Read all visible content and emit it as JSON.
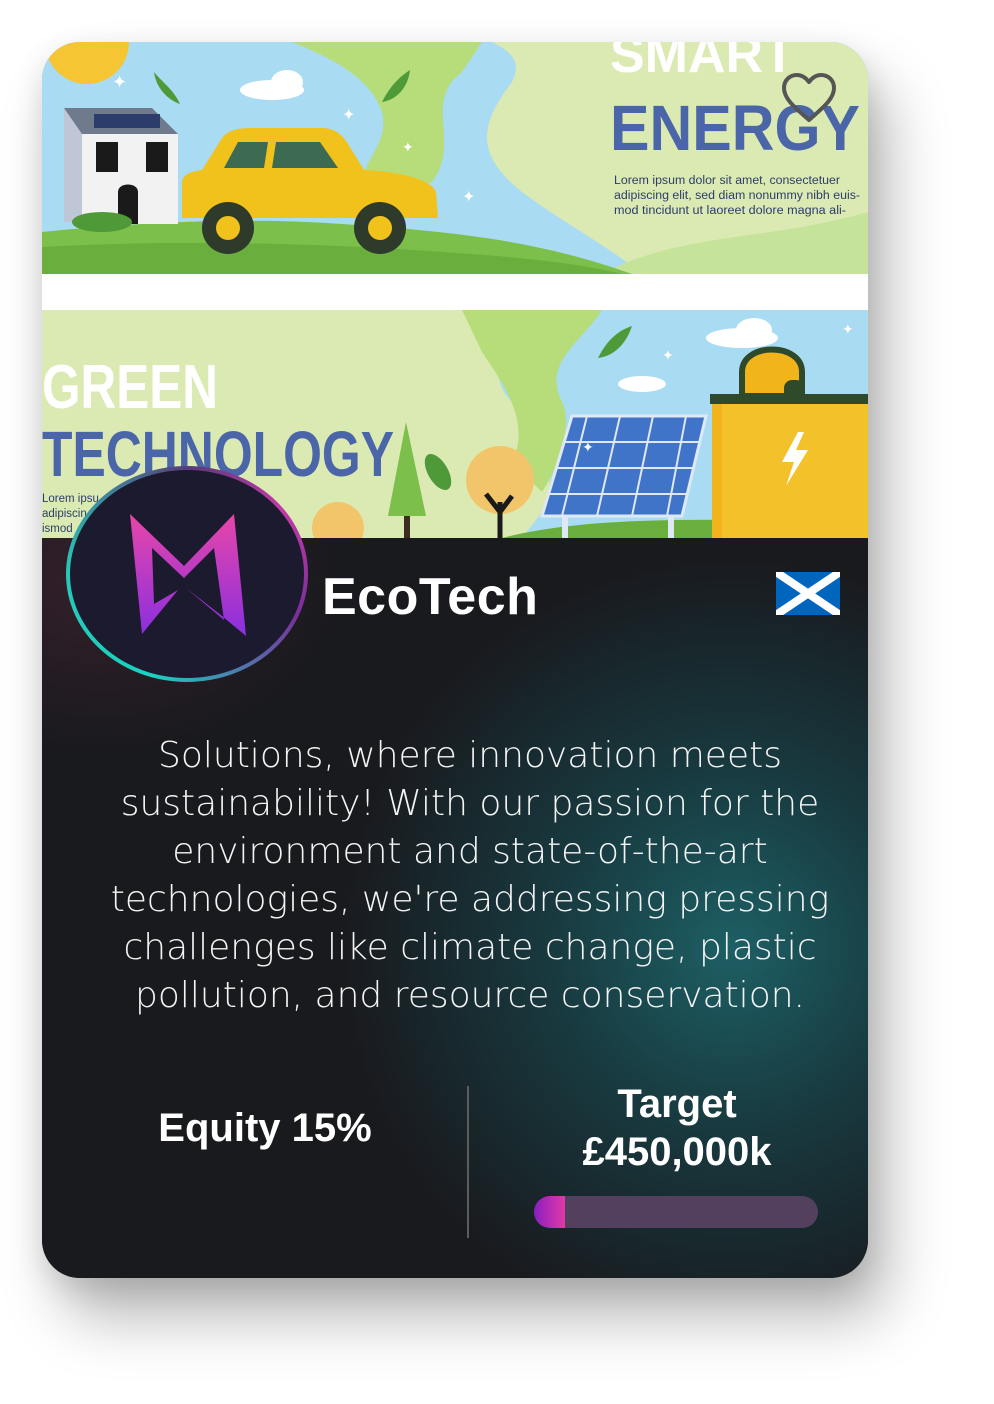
{
  "banner": {
    "top_heading_partial": "SMART",
    "top_heading": "ENERGY",
    "top_body_lines": [
      "Lorem ipsum dolor sit amet, consectetuer",
      "adipiscing elit, sed diam nonummy nibh euis-",
      "mod tincidunt ut laoreet dolore magna ali-"
    ],
    "bottom_heading_1": "GREEN",
    "bottom_heading_2": "TECHNOLOGY",
    "bottom_body_lines": [
      "Lorem ipsu",
      "adipiscin",
      "ismod"
    ]
  },
  "favorite": {
    "icon": "heart-outline-icon"
  },
  "company": {
    "name": "EcoTech",
    "logo_icon": "m-monogram-logo",
    "flag": "scotland-flag-icon",
    "description": "Solutions, where innovation meets sustainability! With our passion for the environment and state-of-the-art technologies, we're addressing pressing challenges like climate change, plastic pollution, and resource conservation."
  },
  "stats": {
    "equity_label": "Equity 15%",
    "target_line1": "Target",
    "target_line2": "£450,000k",
    "progress_fraction": 0.11
  },
  "colors": {
    "progress_track": "#53405f",
    "progress_fill_start": "#8a1ec0",
    "progress_fill_end": "#e03aa5",
    "flag_blue": "#0065bd",
    "heading_blue": "#4a66a8"
  }
}
